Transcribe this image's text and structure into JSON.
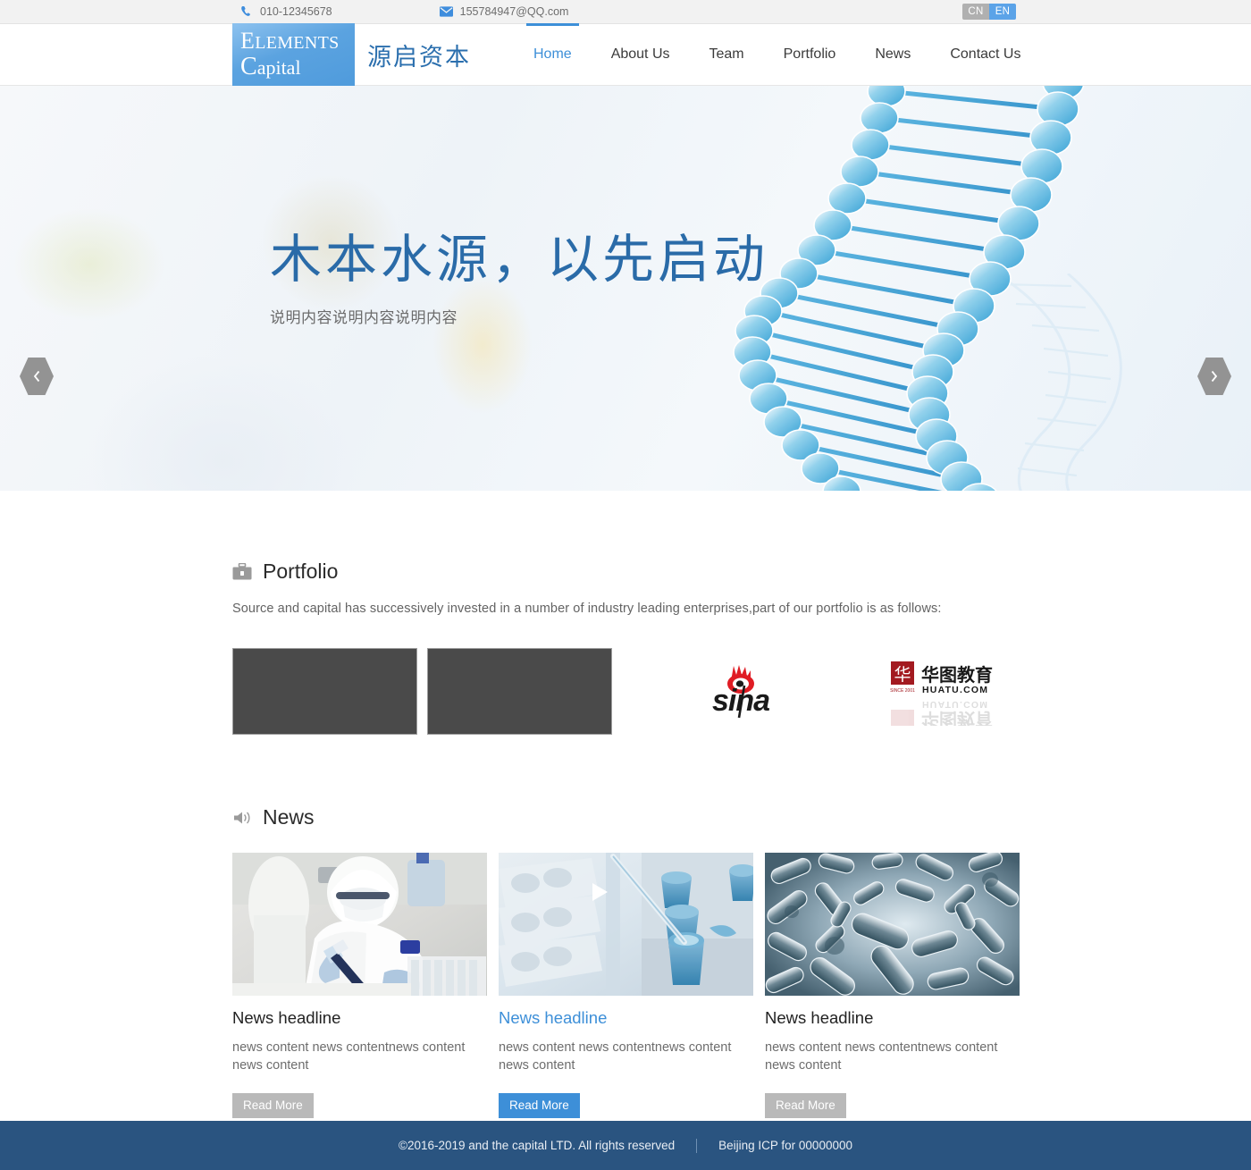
{
  "topbar": {
    "phone_icon": "phone-icon",
    "phone": "010-12345678",
    "email_icon": "envelope-icon",
    "email": "155784947@QQ.com",
    "lang_cn": "CN",
    "lang_en": "EN",
    "active_lang": "EN"
  },
  "header": {
    "logo_line1_cap": "E",
    "logo_line1_rest": "LEMENTS",
    "logo_line2_cap": "C",
    "logo_line2_rest": "apital",
    "logo_cn": "源启资本",
    "nav": [
      {
        "label": "Home",
        "active": true
      },
      {
        "label": "About Us",
        "active": false
      },
      {
        "label": "Team",
        "active": false
      },
      {
        "label": "Portfolio",
        "active": false
      },
      {
        "label": "News",
        "active": false
      },
      {
        "label": "Contact Us",
        "active": false
      }
    ]
  },
  "hero": {
    "title": "木本水源，以先启动",
    "subtitle": "说明内容说明内容说明内容",
    "prev_icon": "chevron-left-icon",
    "next_icon": "chevron-right-icon",
    "dots": [
      {
        "active": false
      },
      {
        "active": true
      },
      {
        "active": false
      },
      {
        "active": false
      }
    ],
    "image_alt": "dna-double-helix"
  },
  "portfolio": {
    "icon": "briefcase-icon",
    "title": "Portfolio",
    "description": "Source and capital has successively invested in a number of industry leading enterprises,part of our portfolio is as follows:",
    "logos": [
      {
        "name": "placeholder-logo-1",
        "type": "placeholder",
        "label": ""
      },
      {
        "name": "placeholder-logo-2",
        "type": "placeholder",
        "label": ""
      },
      {
        "name": "sina-logo",
        "type": "image",
        "label": "sina"
      },
      {
        "name": "huatu-logo",
        "type": "image",
        "label": "华图教育",
        "sub": "HUATU.COM",
        "est": "SINCE 2001"
      }
    ]
  },
  "news": {
    "icon": "speaker-icon",
    "title": "News",
    "cards": [
      {
        "headline": "News headline",
        "body": "news content news contentnews content news content",
        "button": "Read More",
        "highlight": false,
        "image_alt": "lab-scientist-pipetting"
      },
      {
        "headline": "News headline",
        "body": "news content news contentnews content news content",
        "button": "Read More",
        "highlight": true,
        "image_alt": "pipette-and-sample-tubes"
      },
      {
        "headline": "News headline",
        "body": "news content news contentnews content news content",
        "button": "Read More",
        "highlight": false,
        "image_alt": "rod-shaped-bacteria"
      }
    ]
  },
  "footer": {
    "copyright": "©2016-2019 and the capital LTD. All rights reserved",
    "icp": "Beijing ICP for 00000000"
  },
  "colors": {
    "accent_blue": "#3d8fd8",
    "logo_blue": "#5ba3e0",
    "title_blue": "#2a6ba8",
    "footer_blue": "#2a5480",
    "muted_gray": "#b9b9b9",
    "placeholder_gray": "#4a4a4a"
  }
}
